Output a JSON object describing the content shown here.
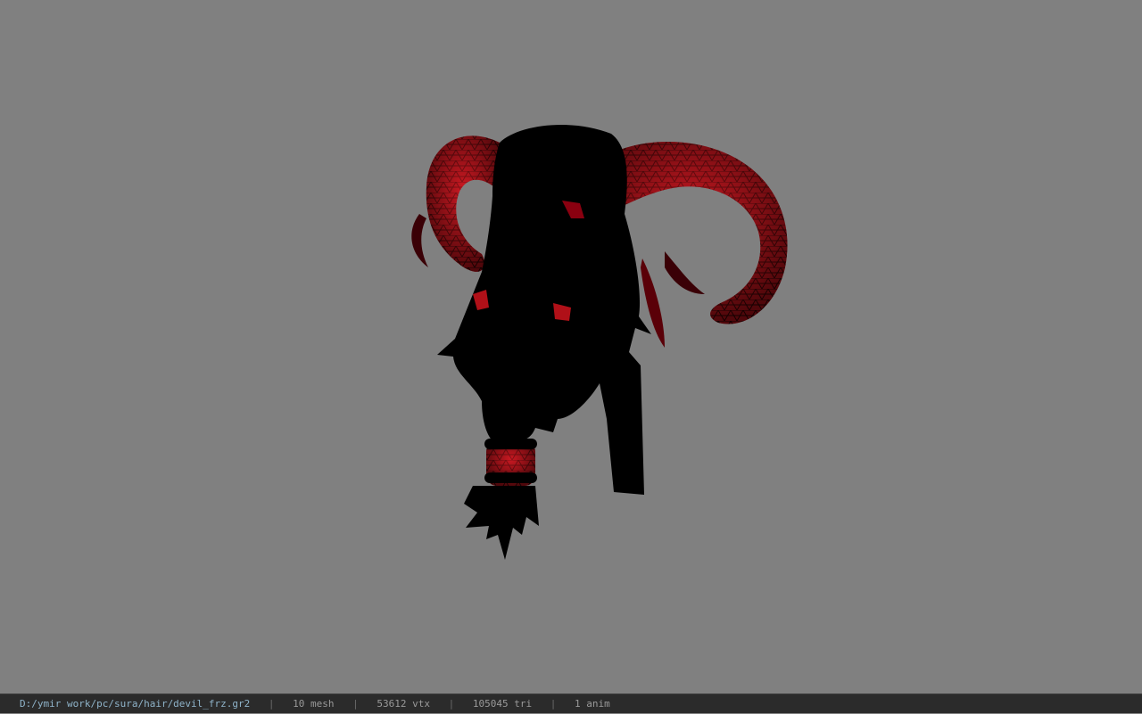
{
  "viewport": {
    "background_color": "#808080",
    "model_colors": {
      "silhouette": "#000000",
      "horn_fill": "#b01018",
      "horn_highlight": "#e0202a",
      "wireframe": "#2a0000"
    }
  },
  "statusbar": {
    "file_path": "D:/ymir work/pc/sura/hair/devil_frz.gr2",
    "separator": "|",
    "mesh_count": "10 mesh",
    "vertex_count": "53612 vtx",
    "triangle_count": "105045 tri",
    "anim_count": "1 anim"
  }
}
